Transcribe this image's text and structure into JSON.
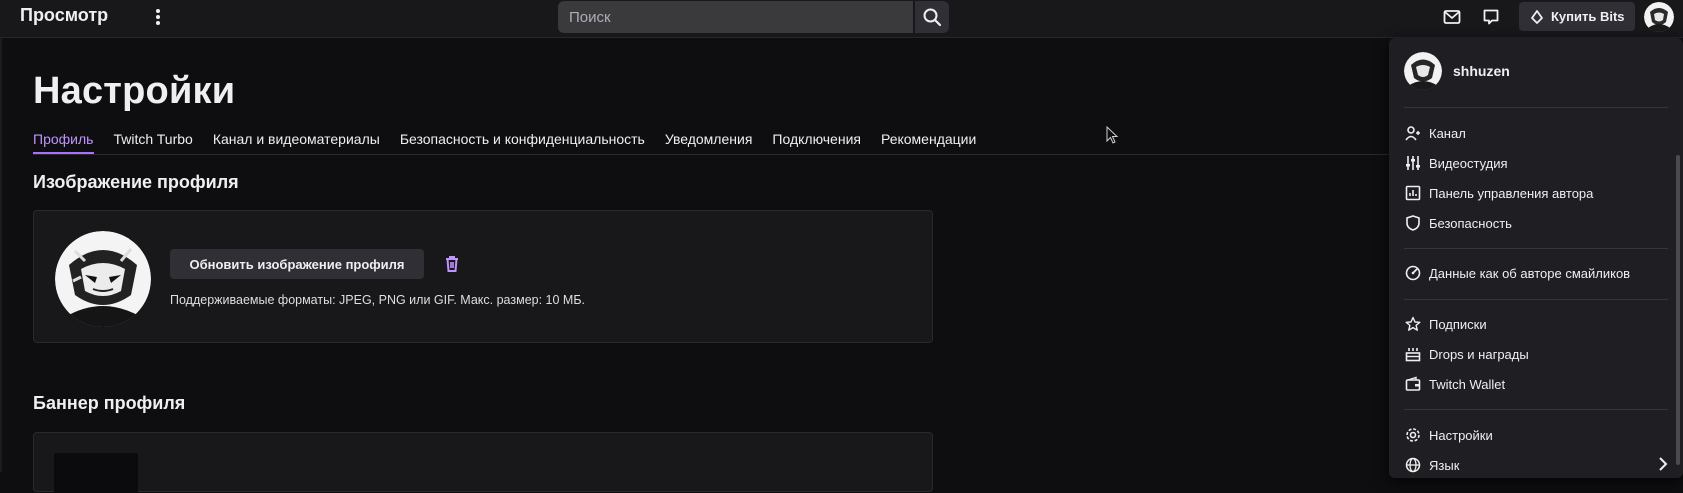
{
  "topbar": {
    "browse_label": "Просмотр",
    "search_placeholder": "Поиск",
    "bits_label": "Купить Bits"
  },
  "page": {
    "title": "Настройки",
    "tabs": [
      {
        "label": "Профиль",
        "active": true
      },
      {
        "label": "Twitch Turbo",
        "active": false
      },
      {
        "label": "Канал и видеоматериалы",
        "active": false
      },
      {
        "label": "Безопасность и конфиденциальность",
        "active": false
      },
      {
        "label": "Уведомления",
        "active": false
      },
      {
        "label": "Подключения",
        "active": false
      },
      {
        "label": "Рекомендации",
        "active": false
      }
    ]
  },
  "profile_image": {
    "section_title": "Изображение профиля",
    "update_button": "Обновить изображение профиля",
    "formats_text": "Поддерживаемые форматы: JPEG, PNG или GIF. Макс. размер: 10 МБ."
  },
  "banner": {
    "section_title": "Баннер профиля"
  },
  "user_menu": {
    "username": "shhuzen",
    "groups": [
      [
        {
          "label": "Канал",
          "icon": "channel-icon"
        },
        {
          "label": "Видеостудия",
          "icon": "sliders-icon"
        },
        {
          "label": "Панель управления автора",
          "icon": "dashboard-icon"
        },
        {
          "label": "Безопасность",
          "icon": "shield-icon"
        }
      ],
      [
        {
          "label": "Данные как об авторе смайликов",
          "icon": "gauge-icon"
        }
      ],
      [
        {
          "label": "Подписки",
          "icon": "star-icon"
        },
        {
          "label": "Drops и награды",
          "icon": "gift-icon"
        },
        {
          "label": "Twitch Wallet",
          "icon": "wallet-icon"
        }
      ],
      [
        {
          "label": "Настройки",
          "icon": "gear-icon"
        },
        {
          "label": "Язык",
          "icon": "globe-icon"
        }
      ]
    ]
  },
  "colors": {
    "accent": "#a970ff",
    "accent_text": "#bf94ff",
    "background": "#0e0e10",
    "surface": "#18181b"
  }
}
